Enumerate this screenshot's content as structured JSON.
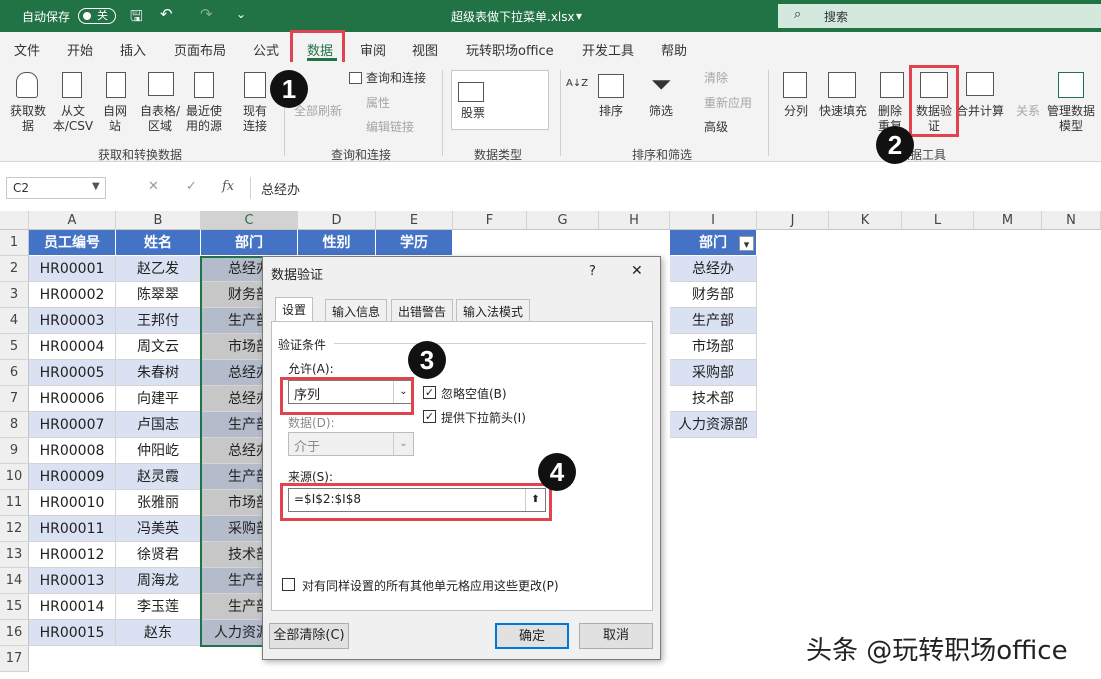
{
  "titlebar": {
    "autosave_label": "自动保存",
    "autosave_state": "关",
    "filename": "超级表做下拉菜单.xlsx",
    "search_placeholder": "搜索"
  },
  "menu": [
    "文件",
    "开始",
    "插入",
    "页面布局",
    "公式",
    "数据",
    "审阅",
    "视图",
    "玩转职场office",
    "开发工具",
    "帮助"
  ],
  "ribbon": {
    "get_data": "获取数据",
    "from_csv": "从文本/CSV",
    "from_web": "自网站",
    "from_table": "自表格/区域",
    "recent_sources": "最近使用的源",
    "existing_conn": "现有连接",
    "refresh_all": "全部刷新",
    "queries_conn": "查询和连接",
    "properties": "属性",
    "edit_links": "编辑链接",
    "stocks": "股票",
    "sort": "排序",
    "filter": "筛选",
    "clear": "清除",
    "reapply": "重新应用",
    "advanced": "高级",
    "split": "分列",
    "flash_fill": "快速填充",
    "remove_dup": "删除重复值",
    "data_validation": "数据验证",
    "consolidate": "合并计算",
    "relationships": "关系",
    "manage_model": "管理数据模型",
    "groups": [
      "获取和转换数据",
      "查询和连接",
      "数据类型",
      "排序和筛选",
      "数据工具"
    ]
  },
  "formula_bar": {
    "name_box": "C2",
    "fx": "fx",
    "formula": "总经办"
  },
  "columns": [
    "A",
    "B",
    "C",
    "D",
    "E",
    "F",
    "G",
    "H",
    "I",
    "J",
    "K",
    "L",
    "M",
    "N"
  ],
  "rows": [
    "1",
    "2",
    "3",
    "4",
    "5",
    "6",
    "7",
    "8",
    "9",
    "10",
    "11",
    "12",
    "13",
    "14",
    "15",
    "16",
    "17"
  ],
  "table": {
    "headers": [
      "员工编号",
      "姓名",
      "部门",
      "性别",
      "学历"
    ],
    "ids": [
      "HR00001",
      "HR00002",
      "HR00003",
      "HR00004",
      "HR00005",
      "HR00006",
      "HR00007",
      "HR00008",
      "HR00009",
      "HR00010",
      "HR00011",
      "HR00012",
      "HR00013",
      "HR00014",
      "HR00015"
    ],
    "names": [
      "赵乙发",
      "陈翠翠",
      "王邦付",
      "周文云",
      "朱春树",
      "向建平",
      "卢国志",
      "仲阳屹",
      "赵灵霞",
      "张雅丽",
      "冯美英",
      "徐贤君",
      "周海龙",
      "李玉莲",
      "赵东"
    ],
    "depts": [
      "总经办",
      "财务部",
      "生产部",
      "市场部",
      "总经办",
      "总经办",
      "生产部",
      "总经办",
      "生产部",
      "市场部",
      "采购部",
      "技术部",
      "生产部",
      "生产部",
      "人力资源部"
    ]
  },
  "dept_list": {
    "header": "部门",
    "items": [
      "总经办",
      "财务部",
      "生产部",
      "市场部",
      "采购部",
      "技术部",
      "人力资源部"
    ]
  },
  "dialog": {
    "title": "数据验证",
    "help": "?",
    "close": "✕",
    "tabs": [
      "设置",
      "输入信息",
      "出错警告",
      "输入法模式"
    ],
    "section": "验证条件",
    "allow_label": "允许(A):",
    "allow_value": "序列",
    "ignore_blank": "忽略空值(B)",
    "dropdown_arrow": "提供下拉箭头(I)",
    "data_label": "数据(D):",
    "data_value": "介于",
    "source_label": "来源(S):",
    "source_value": "=$I$2:$I$8",
    "apply_all": "对有同样设置的所有其他单元格应用这些更改(P)",
    "clear_all": "全部清除(C)",
    "ok": "确定",
    "cancel": "取消"
  },
  "badges": [
    "1",
    "2",
    "3",
    "4"
  ],
  "watermark": "头条 @玩转职场office",
  "colors": {
    "accent": "#217346",
    "table_header": "#4472c4",
    "band": "#d9e1f2",
    "highlight": "#e0454f"
  }
}
